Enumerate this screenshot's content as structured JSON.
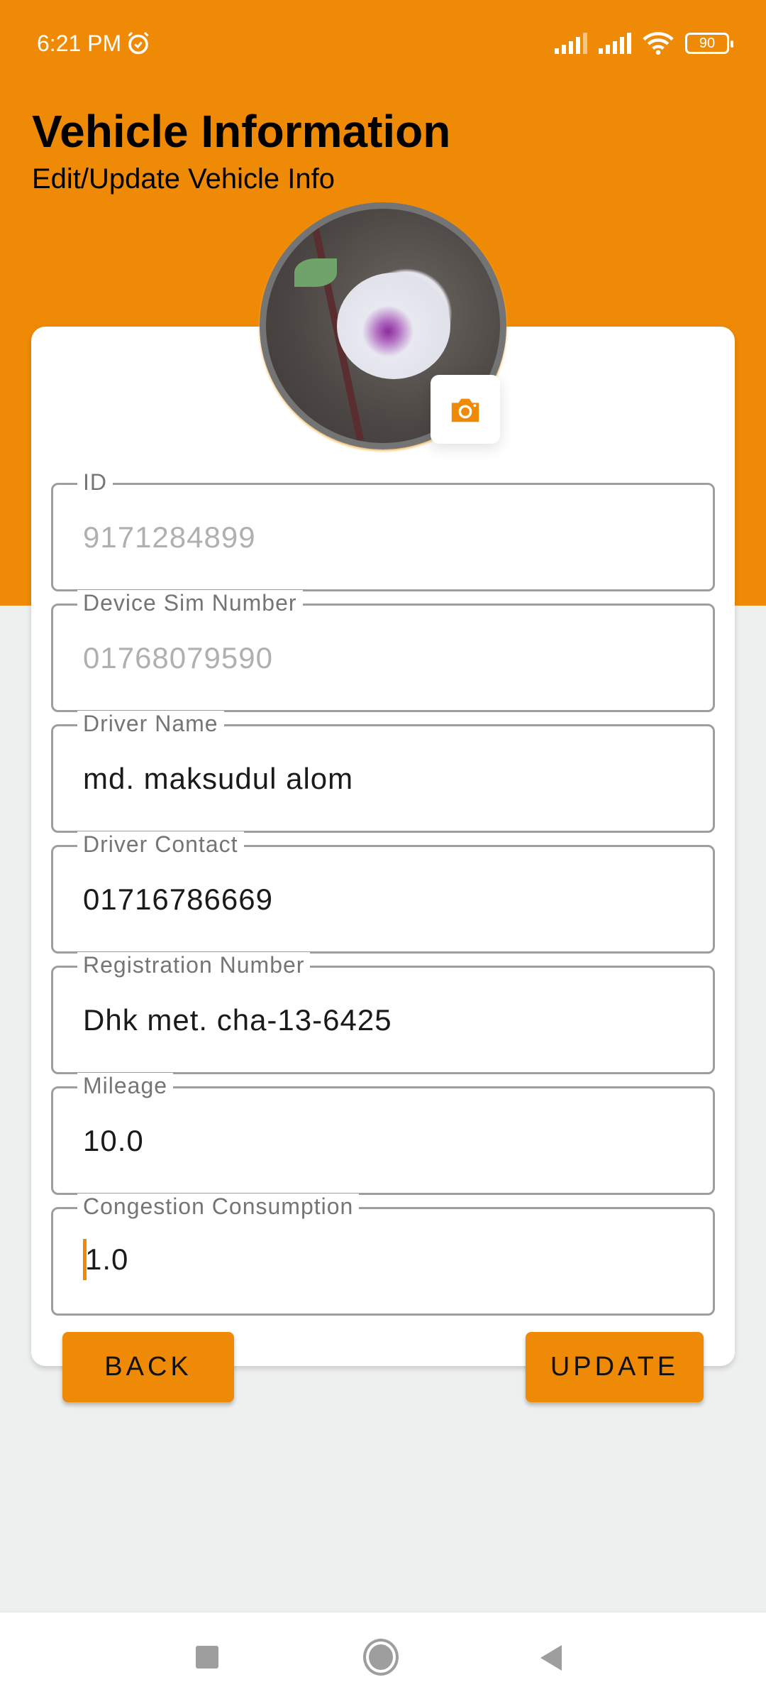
{
  "status_bar": {
    "time": "6:21 PM",
    "battery": "90"
  },
  "header": {
    "title": "Vehicle Information",
    "subtitle": "Edit/Update Vehicle Info"
  },
  "fields": [
    {
      "label": "ID",
      "value": "9171284899",
      "enabled": false
    },
    {
      "label": "Device Sim Number",
      "value": "01768079590",
      "enabled": false
    },
    {
      "label": "Driver Name",
      "value": "md. maksudul alom",
      "enabled": true
    },
    {
      "label": "Driver Contact",
      "value": "01716786669",
      "enabled": true
    },
    {
      "label": "Registration Number",
      "value": "Dhk met. cha-13-6425",
      "enabled": true
    },
    {
      "label": "Mileage",
      "value": "10.0",
      "enabled": true
    },
    {
      "label": "Congestion Consumption",
      "value": "1.0",
      "enabled": true,
      "focused": true
    }
  ],
  "buttons": {
    "back": "BACK",
    "update": "UPDATE"
  },
  "colors": {
    "accent": "#ef8a07",
    "background": "#eef0ef"
  }
}
